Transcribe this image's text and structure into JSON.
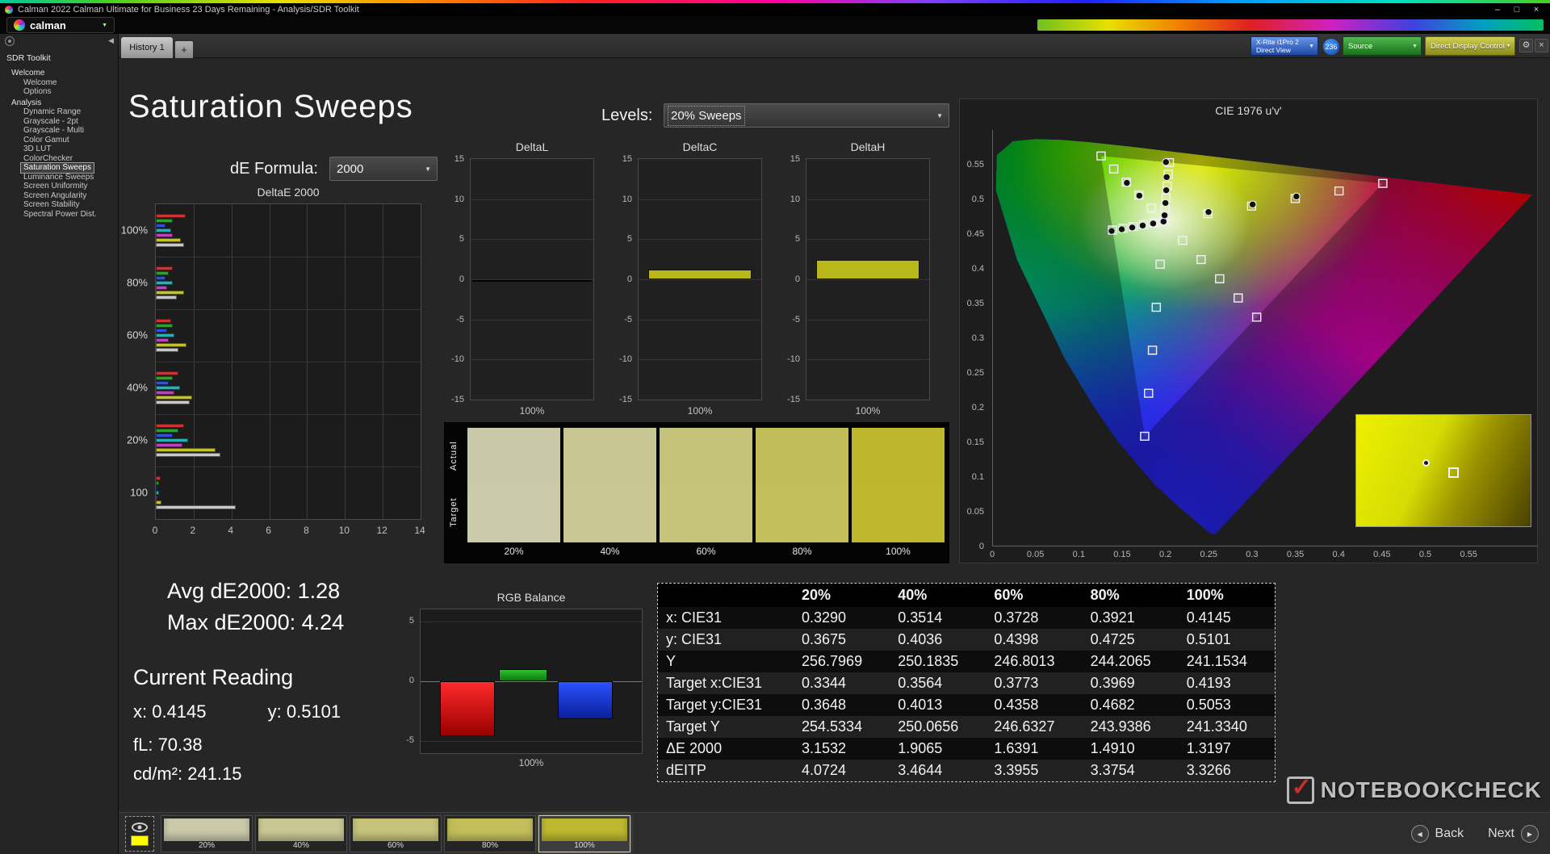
{
  "window": {
    "title": "Calman 2022 Calman Ultimate for Business 23 Days Remaining  - Analysis/SDR Toolkit"
  },
  "icons": {
    "minimize": "–",
    "maximize": "□",
    "close": "×",
    "caret": "▼",
    "gear": "⚙",
    "collapse": "◀",
    "back_arrow": "◀",
    "next_arrow": "▶",
    "check": "✓"
  },
  "brand": {
    "name": "calman"
  },
  "tabs": {
    "history": "History 1",
    "add": "+"
  },
  "device_bar": {
    "meter_line1": "X-Rite i1Pro 2",
    "meter_line2": "Direct View",
    "badge": "236",
    "source": "Source",
    "display_control": "Direct Display Control"
  },
  "sidebar": {
    "title": "SDR Toolkit",
    "selected": "Saturation Sweeps",
    "groups": [
      {
        "label": "Welcome",
        "items": [
          "Welcome",
          "Options"
        ]
      },
      {
        "label": "Analysis",
        "items": [
          "Dynamic Range",
          "Grayscale - 2pt",
          "Grayscale - Multi",
          "Color Gamut",
          "3D LUT",
          "ColorChecker",
          "Saturation Sweeps",
          "Luminance Sweeps",
          "Screen Uniformity",
          "Screen Angularity",
          "Screen Stability",
          "Spectral Power Dist."
        ]
      }
    ]
  },
  "page": {
    "title": "Saturation Sweeps",
    "levels_label": "Levels:",
    "levels_value": "20% Sweeps",
    "formula_label": "dE Formula:",
    "formula_value": "2000"
  },
  "chart_data": [
    {
      "id": "deltae2000",
      "type": "bar",
      "title": "DeltaE 2000",
      "orientation": "horizontal",
      "xlim": [
        0,
        14
      ],
      "x_ticks": [
        0,
        2,
        4,
        6,
        8,
        10,
        12,
        14
      ],
      "series_colors": [
        "#d03232",
        "#2ea02e",
        "#3050e0",
        "#2ab0b0",
        "#c040c0",
        "#c2c22a",
        "#c8c8c8"
      ],
      "groups": [
        {
          "label": "100%",
          "values": [
            1.6,
            0.9,
            0.5,
            0.8,
            0.9,
            1.32,
            1.5
          ]
        },
        {
          "label": "80%",
          "values": [
            0.9,
            0.7,
            0.5,
            0.9,
            0.6,
            1.49,
            1.1
          ]
        },
        {
          "label": "60%",
          "values": [
            0.8,
            0.9,
            0.6,
            1.0,
            0.7,
            1.64,
            1.2
          ]
        },
        {
          "label": "40%",
          "values": [
            1.2,
            0.9,
            0.7,
            1.3,
            1.0,
            1.91,
            1.8
          ]
        },
        {
          "label": "20%",
          "values": [
            1.5,
            1.2,
            0.9,
            1.7,
            1.4,
            3.15,
            3.4
          ]
        },
        {
          "label": "100",
          "values": [
            0.25,
            0.15,
            0.1,
            0.15,
            0.1,
            0.3,
            4.24
          ]
        }
      ]
    },
    {
      "id": "delta_trio",
      "type": "bar",
      "ylim": [
        -15,
        15
      ],
      "y_ticks": [
        15,
        10,
        5,
        0,
        -5,
        -10,
        -15
      ],
      "x_label": "100%",
      "panels": [
        {
          "title": "DeltaL",
          "style": "line",
          "value": -0.2,
          "color": "#000000"
        },
        {
          "title": "DeltaC",
          "style": "bar",
          "value": 1.2,
          "color": "#b8b81a"
        },
        {
          "title": "DeltaH",
          "style": "bar",
          "value": 2.4,
          "color": "#b8b81a"
        }
      ]
    },
    {
      "id": "rgb_balance",
      "type": "bar",
      "title": "RGB Balance",
      "ylim": [
        -6,
        6
      ],
      "y_ticks": [
        5,
        0,
        -5
      ],
      "x_label": "100%",
      "categories": [
        "Red",
        "Green",
        "Blue"
      ],
      "values": [
        -4.6,
        1.0,
        -3.2
      ],
      "colors": [
        "#dd1111",
        "#11a011",
        "#2233dd"
      ]
    },
    {
      "id": "cie1976",
      "type": "scatter",
      "title": "CIE 1976 u'v'",
      "xlim": [
        0,
        0.63
      ],
      "ylim": [
        0,
        0.6
      ],
      "x_ticks": [
        0,
        0.05,
        0.1,
        0.15,
        0.2,
        0.25,
        0.3,
        0.35,
        0.4,
        0.45,
        0.5,
        0.55
      ],
      "y_ticks": [
        0,
        0.05,
        0.1,
        0.15,
        0.2,
        0.25,
        0.3,
        0.35,
        0.4,
        0.45,
        0.5,
        0.55
      ],
      "targets": [
        [
          0.1978,
          0.4683
        ],
        [
          0.2484,
          0.4792
        ],
        [
          0.299,
          0.4901
        ],
        [
          0.3495,
          0.5011
        ],
        [
          0.4001,
          0.512
        ],
        [
          0.4507,
          0.5229
        ],
        [
          0.1832,
          0.4871
        ],
        [
          0.1687,
          0.506
        ],
        [
          0.1541,
          0.5248
        ],
        [
          0.1396,
          0.5437
        ],
        [
          0.125,
          0.5625
        ],
        [
          0.1933,
          0.4062
        ],
        [
          0.1888,
          0.3441
        ],
        [
          0.1844,
          0.2821
        ],
        [
          0.1799,
          0.22
        ],
        [
          0.1754,
          0.1579
        ],
        [
          0.2192,
          0.4406
        ],
        [
          0.2406,
          0.4129
        ],
        [
          0.2621,
          0.3852
        ],
        [
          0.2835,
          0.3575
        ],
        [
          0.3049,
          0.3298
        ],
        [
          0.1859,
          0.4657
        ],
        [
          0.174,
          0.4632
        ],
        [
          0.1621,
          0.4606
        ],
        [
          0.1502,
          0.4581
        ],
        [
          0.1383,
          0.4555
        ],
        [
          0.199,
          0.4852
        ],
        [
          0.2002,
          0.5021
        ],
        [
          0.2015,
          0.5191
        ],
        [
          0.2027,
          0.536
        ],
        [
          0.2039,
          0.5529
        ]
      ],
      "measured": [
        [
          0.1972,
          0.4678
        ],
        [
          0.1984,
          0.4768
        ],
        [
          0.1994,
          0.4946
        ],
        [
          0.2003,
          0.513
        ],
        [
          0.2008,
          0.532
        ],
        [
          0.2,
          0.5536
        ],
        [
          0.1852,
          0.465
        ],
        [
          0.1731,
          0.4621
        ],
        [
          0.161,
          0.4592
        ],
        [
          0.1489,
          0.4566
        ],
        [
          0.1372,
          0.4542
        ],
        [
          0.2492,
          0.4815
        ],
        [
          0.3002,
          0.4925
        ],
        [
          0.3508,
          0.504
        ],
        [
          0.1692,
          0.5052
        ],
        [
          0.1548,
          0.5236
        ]
      ]
    }
  ],
  "swatches": {
    "row_labels": [
      "Actual",
      "Target"
    ],
    "items": [
      {
        "label": "20%",
        "actual": "#c9c8a8",
        "target": "#cbcaa9"
      },
      {
        "label": "40%",
        "actual": "#c8c693",
        "target": "#c9c794"
      },
      {
        "label": "60%",
        "actual": "#c5c379",
        "target": "#c6c47a"
      },
      {
        "label": "80%",
        "actual": "#c1bd59",
        "target": "#c2be5a"
      },
      {
        "label": "100%",
        "actual": "#bcb72c",
        "target": "#bdb82e"
      }
    ]
  },
  "readings": {
    "avg": "Avg dE2000: 1.28",
    "max": "Max dE2000: 4.24",
    "current_title": "Current Reading",
    "x": "x: 0.4145",
    "y": "y: 0.5101",
    "fl": "fL: 70.38",
    "cd": "cd/m²: 241.15"
  },
  "table": {
    "columns": [
      "",
      "20%",
      "40%",
      "60%",
      "80%",
      "100%"
    ],
    "rows": [
      {
        "label": "x: CIE31",
        "values": [
          "0.3290",
          "0.3514",
          "0.3728",
          "0.3921",
          "0.4145"
        ]
      },
      {
        "label": "y: CIE31",
        "values": [
          "0.3675",
          "0.4036",
          "0.4398",
          "0.4725",
          "0.5101"
        ]
      },
      {
        "label": "Y",
        "values": [
          "256.7969",
          "250.1835",
          "246.8013",
          "244.2065",
          "241.1534"
        ]
      },
      {
        "label": "Target x:CIE31",
        "values": [
          "0.3344",
          "0.3564",
          "0.3773",
          "0.3969",
          "0.4193"
        ]
      },
      {
        "label": "Target y:CIE31",
        "values": [
          "0.3648",
          "0.4013",
          "0.4358",
          "0.4682",
          "0.5053"
        ]
      },
      {
        "label": "Target Y",
        "values": [
          "254.5334",
          "250.0656",
          "246.6327",
          "243.9386",
          "241.3340"
        ]
      },
      {
        "label": "ΔE 2000",
        "values": [
          "3.1532",
          "1.9065",
          "1.6391",
          "1.4910",
          "1.3197"
        ]
      },
      {
        "label": "dEITP",
        "values": [
          "4.0724",
          "3.4644",
          "3.3955",
          "3.3754",
          "3.3266"
        ]
      }
    ]
  },
  "bottom": {
    "thumbs": [
      {
        "label": "20%",
        "color": "#cac9a9",
        "selected": false
      },
      {
        "label": "40%",
        "color": "#c9c794",
        "selected": false
      },
      {
        "label": "60%",
        "color": "#c6c47a",
        "selected": false
      },
      {
        "label": "80%",
        "color": "#c2bf5b",
        "selected": false
      },
      {
        "label": "100%",
        "color": "#bdb82e",
        "selected": true
      }
    ],
    "back": "Back",
    "next": "Next"
  },
  "watermark": {
    "text": "NOTEBOOKCHECK"
  }
}
